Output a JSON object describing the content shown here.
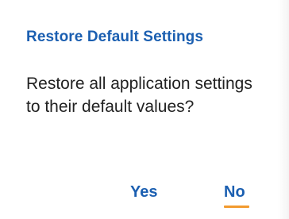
{
  "dialog": {
    "title": "Restore Default Settings",
    "message": "Restore all application settings to their default values?",
    "buttons": {
      "yes_label": "Yes",
      "no_label": "No",
      "focused": "No"
    }
  },
  "colors": {
    "accent": "#1b5fb1",
    "text": "#222222",
    "focus": "#f29a2e",
    "background": "#ffffff"
  }
}
